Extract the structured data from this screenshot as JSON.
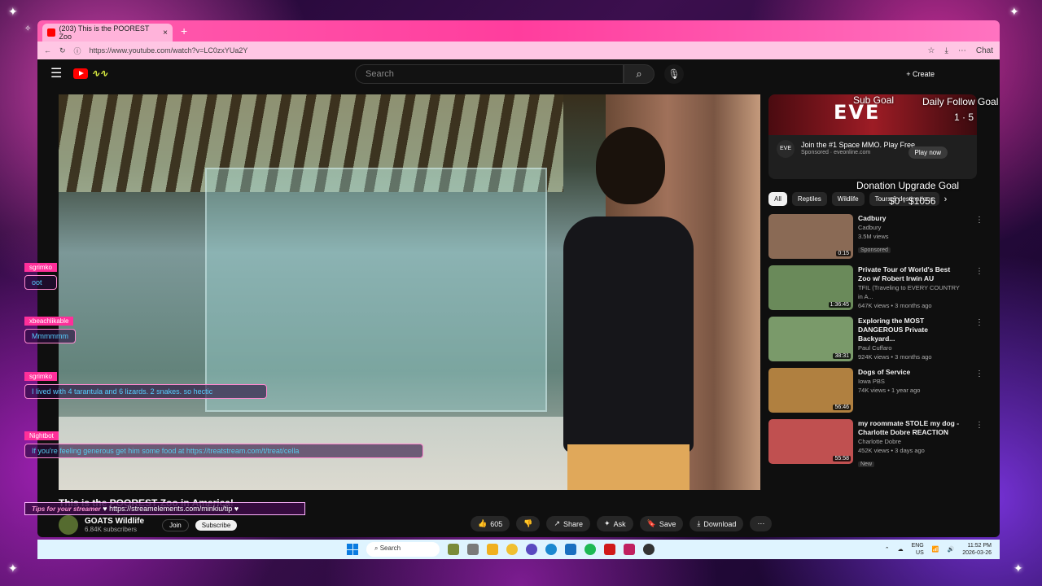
{
  "browser": {
    "tab_title": "(203) This is the POOREST Zoo",
    "new_tab": "+",
    "address": "https://www.youtube.com/watch?v=LC0zxYUa2Y",
    "chat_label": "Chat"
  },
  "youtube": {
    "search_placeholder": "Search",
    "create_label": "Create",
    "video": {
      "title": "This is the POOREST Zoo in America!",
      "channel": "GOATS Wildlife",
      "subscribers": "6.84K subscribers",
      "join": "Join",
      "subscribe": "Subscribe"
    },
    "actions": {
      "likes": "605",
      "share": "Share",
      "ask": "Ask",
      "save": "Save",
      "download": "Download"
    },
    "ad": {
      "brand": "EVE",
      "title": "Join the #1 Space MMO. Play Free",
      "sponsored": "Sponsored",
      "domain": "eveonline.com",
      "cta": "Play now"
    },
    "chips": [
      "All",
      "Reptiles",
      "Wildlife",
      "Tours & destinations"
    ],
    "recommendations": [
      {
        "title": "Cadbury",
        "channel": "Cadbury",
        "meta": "3.5M views",
        "badge": "Sponsored",
        "duration": "0:15",
        "color": "#8a6a55"
      },
      {
        "title": "Private Tour of World's Best Zoo w/ Robert Irwin AU",
        "channel": "TFIL (Traveling to EVERY COUNTRY in A...",
        "meta": "647K views • 3 months ago",
        "badge": "",
        "duration": "1:36:45",
        "color": "#6a8a5a"
      },
      {
        "title": "Exploring the MOST DANGEROUS Private Backyard...",
        "channel": "Paul Cuffaro",
        "meta": "924K views • 3 months ago",
        "badge": "",
        "duration": "38:31",
        "color": "#7a9a6a"
      },
      {
        "title": "Dogs of Service",
        "channel": "Iowa PBS",
        "meta": "74K views • 1 year ago",
        "badge": "",
        "duration": "56:46",
        "color": "#b08040"
      },
      {
        "title": "my roommate STOLE my dog - Charlotte Dobre REACTION",
        "channel": "Charlotte Dobre",
        "meta": "452K views • 3 days ago",
        "badge": "New",
        "duration": "55:58",
        "color": "#c05050"
      }
    ]
  },
  "overlay": {
    "sub_goal": "Sub Goal",
    "follow_goal": "Daily Follow Goal",
    "follow_count": "1 · 5",
    "donation_goal": "Donation Upgrade Goal",
    "donation_amount": "$0 · $1056",
    "chat": [
      {
        "name": "sgrimko",
        "text": "oot"
      },
      {
        "name": "xbeachlikable",
        "text": "Mmmmmm"
      },
      {
        "name": "sgrimko",
        "text": "I lived with 4 tarantula and 6 lizards. 2 snakes. so hectic"
      },
      {
        "name": "Nightbot",
        "text": "If you're feeling generous get him some food at https://treatstream.com/t/treat/cella"
      }
    ],
    "tip_label": "Tips for your streamer",
    "tip_url": "https://streamelements.com/minkiu/tip"
  },
  "taskbar": {
    "search": "Search",
    "lang": "ENG",
    "region": "US",
    "time": "11:52 PM",
    "date": "2026-03-26"
  }
}
